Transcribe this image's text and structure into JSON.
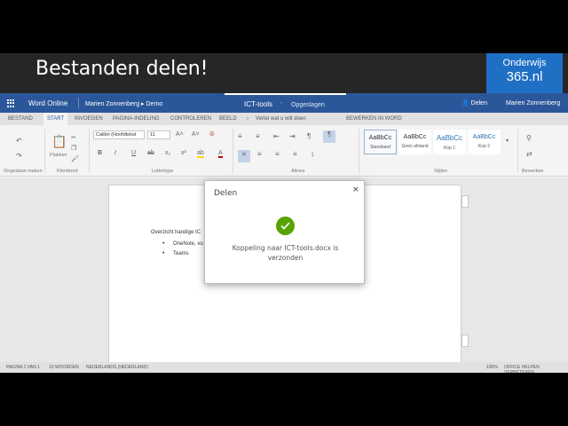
{
  "banner": {
    "title": "Bestanden delen!",
    "brand_line1": "Onderwijs",
    "brand_line2": "365.nl"
  },
  "topbar": {
    "app_name": "Word Online",
    "breadcrumb": "Marien Zonnenberg ▸ Demo",
    "doc_title": "ICT-tools",
    "doc_sep": "-",
    "save_status": "Opgeslagen",
    "share_label": "Delen",
    "user_name": "Marien Zonnenberg"
  },
  "tabs": [
    "BESTAND",
    "START",
    "INVOEGEN",
    "PAGINA-INDELING",
    "CONTROLEREN",
    "BEELD"
  ],
  "tell_me": "Vertel wat u wilt doen",
  "open_in_word": "BEWERKEN IN WORD",
  "ribbon": {
    "undo_label": "Ongedaan maken",
    "paste_label": "Plakken",
    "clipboard_label": "Klembord",
    "font_name": "Calibri (Hoofdtekst",
    "font_size": "11",
    "font_label": "Lettertype",
    "paragraph_label": "Alinea",
    "styles_label": "Stijlen",
    "editing_label": "Bewerken",
    "styles": [
      {
        "preview": "AaBbCc",
        "name": "Standaard"
      },
      {
        "preview": "AaBbCc",
        "name": "Geen afstand"
      },
      {
        "preview": "AaBbCc",
        "name": "Kop 1"
      },
      {
        "preview": "AaBbCc",
        "name": "Kop 2"
      }
    ]
  },
  "document": {
    "line1": "Overzicht handige IC",
    "bullets": [
      "OneNote, vo",
      "Teams"
    ]
  },
  "status": {
    "page": "PAGINA 1 VAN 1",
    "words": "10 WOORDEN",
    "language": "NEDERLANDS (NEDERLAND)",
    "zoom": "100%",
    "help": "OFFICE HELPEN VERBETEREN"
  },
  "dialog": {
    "title": "Delen",
    "close": "×",
    "message": "Koppeling naar ICT-tools.docx is verzonden"
  },
  "colors": {
    "word_blue": "#2b579a",
    "success_green": "#57a300",
    "brand_blue": "#1f6fc4"
  }
}
